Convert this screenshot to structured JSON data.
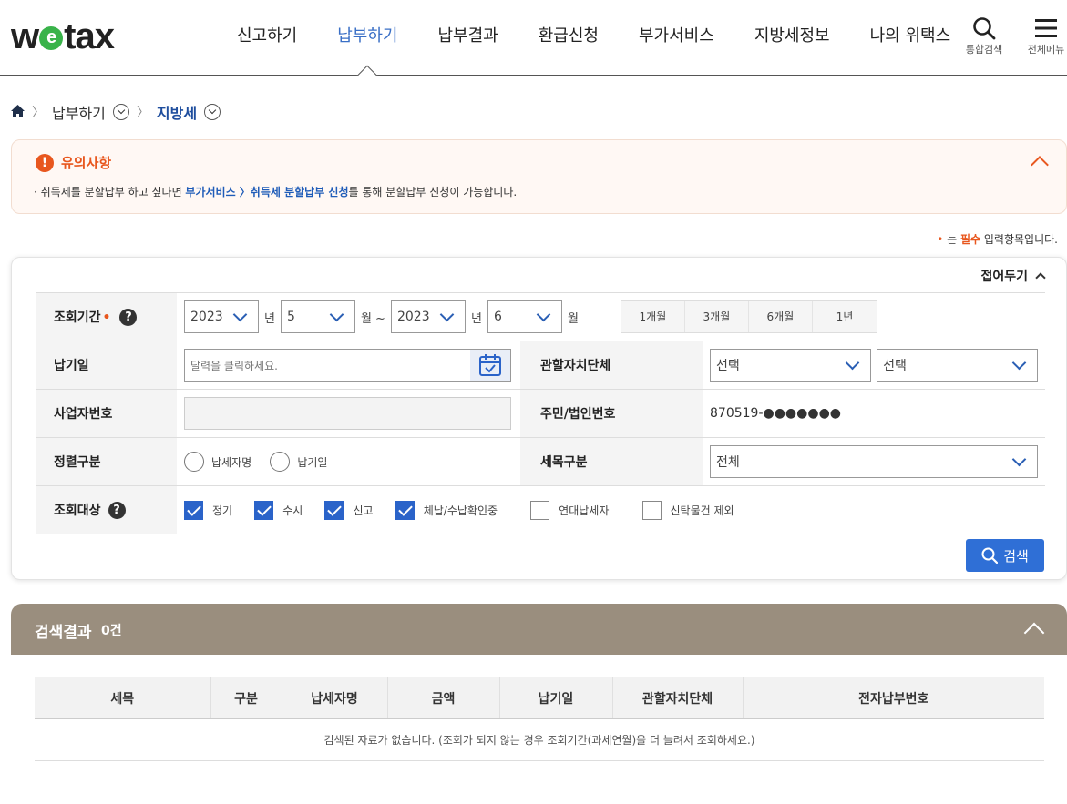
{
  "header": {
    "logo": {
      "left": "w",
      "mid": "e",
      "right": "tax"
    },
    "nav": [
      "신고하기",
      "납부하기",
      "납부결과",
      "환급신청",
      "부가서비스",
      "지방세정보",
      "나의 위택스"
    ],
    "active_index": 1,
    "search_label": "통합검색",
    "menu_label": "전체메뉴"
  },
  "breadcrumb": {
    "level1": "납부하기",
    "level2": "지방세"
  },
  "notice": {
    "title": "유의사항",
    "bullet": "·",
    "text_before": " 취득세를 분할납부 하고 싶다면 ",
    "link": "부가서비스 〉취득세 분할납부 신청",
    "text_after": "를 통해 분할납부 신청이 가능합니다."
  },
  "required_note": {
    "dot": "•",
    "pre": " 는 ",
    "bold": "필수",
    "post": " 입력항목입니다."
  },
  "form": {
    "fold_label": "접어두기",
    "period": {
      "label": "조회기간",
      "start_year": "2023",
      "start_month": "5",
      "end_year": "2023",
      "end_month": "6",
      "unit_year": "년",
      "unit_month_range": "월 ~",
      "unit_month": "월",
      "quick": [
        "1개월",
        "3개월",
        "6개월",
        "1년"
      ]
    },
    "due_date": {
      "label": "납기일",
      "placeholder": "달력을 클릭하세요."
    },
    "authority": {
      "label": "관할자치단체",
      "select1": "선택",
      "select2": "선택"
    },
    "biz_no": {
      "label": "사업자번호",
      "value": ""
    },
    "resident_no": {
      "label": "주민/법인번호",
      "value": "870519-●●●●●●●"
    },
    "sort": {
      "label": "정렬구분",
      "options": [
        "납세자명",
        "납기일"
      ]
    },
    "tax_item": {
      "label": "세목구분",
      "value": "전체"
    },
    "target": {
      "label": "조회대상",
      "options": [
        {
          "label": "정기",
          "checked": true
        },
        {
          "label": "수시",
          "checked": true
        },
        {
          "label": "신고",
          "checked": true
        },
        {
          "label": "체납/수납확인중",
          "checked": true
        },
        {
          "label": "연대납세자",
          "checked": false
        },
        {
          "label": "신탁물건 제외",
          "checked": false
        }
      ]
    },
    "search_button": "검색"
  },
  "results": {
    "title": "검색결과",
    "count": "0건",
    "columns": [
      "세목",
      "구분",
      "납세자명",
      "금액",
      "납기일",
      "관할자치단체",
      "전자납부번호"
    ],
    "empty_message": "검색된 자료가 없습니다. (조회가 되지 않는 경우 조회기간(과세연월)을 더 늘려서 조회하세요.)"
  },
  "colors": {
    "accent": "#2f6fd6",
    "warning": "#e8571e",
    "result_header": "#9a8e7e",
    "logo_green": "#39b34a"
  }
}
